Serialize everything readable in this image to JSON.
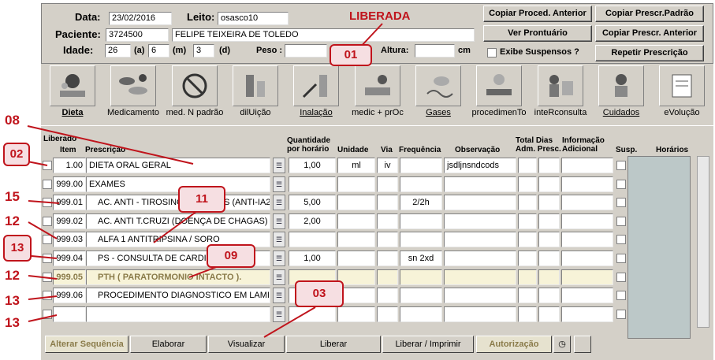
{
  "header": {
    "data_label": "Data:",
    "data_value": "23/02/2016",
    "leito_label": "Leito:",
    "leito_value": "osasco10",
    "status": "LIBERADA",
    "paciente_label": "Paciente:",
    "paciente_id": "3724500",
    "paciente_nome": "FELIPE TEIXEIRA DE TOLEDO",
    "idade_label": "Idade:",
    "idade_anos": "26",
    "anos_unit": "(a)",
    "idade_meses": "6",
    "meses_unit": "(m)",
    "idade_dias": "3",
    "dias_unit": "(d)",
    "peso_label": "Peso :",
    "peso_unit": "kg",
    "altura_label": "Altura:",
    "altura_unit": "cm",
    "exibe_suspensos": "Exibe Suspensos ?"
  },
  "actions": {
    "copiar_proced": "Copiar Proced. Anterior",
    "copiar_padrao": "Copiar Prescr.Padrão",
    "ver_prontuario": "Ver Prontuário",
    "copiar_anterior": "Copiar Prescr. Anterior",
    "repetir": "Repetir Prescrição"
  },
  "toolbar": [
    {
      "label": "Dieta",
      "icon": "meal-icon"
    },
    {
      "label": "Medicamento",
      "icon": "pills-icon"
    },
    {
      "label": "med. N padrão",
      "icon": "no-medicine-icon"
    },
    {
      "label": "dilUição",
      "icon": "vial-icon"
    },
    {
      "label": "Inalação",
      "icon": "inhaler-icon"
    },
    {
      "label": "medic + prOc",
      "icon": "medic-procedure-icon"
    },
    {
      "label": "Gases",
      "icon": "gas-icon"
    },
    {
      "label": "procedimenTo",
      "icon": "procedure-icon"
    },
    {
      "label": "inteRconsulta",
      "icon": "consultation-icon"
    },
    {
      "label": "Cuidados",
      "icon": "care-icon"
    },
    {
      "label": "eVolução",
      "icon": "evolution-icon"
    }
  ],
  "grid": {
    "headers": {
      "liberado": "Liberado",
      "item": "Item",
      "prescricao": "Prescrição",
      "quantidade": "Quantidade por horário",
      "unidade": "Unidade",
      "via": "Via",
      "frequencia": "Frequência",
      "observacao": "Observação",
      "total_dias": "Total Dias Adm. Presc.",
      "informacao": "Informação Adicional",
      "susp": "Susp.",
      "horarios": "Horários"
    },
    "rows": [
      {
        "item": "1.00",
        "prescricao": "DIETA ORAL GERAL",
        "quantidade": "1,00",
        "unidade": "ml",
        "via": "iv",
        "frequencia": "",
        "observacao": "jsdljnsndcods"
      },
      {
        "item": "999.00",
        "prescricao": "EXAMES",
        "quantidade": "",
        "unidade": "",
        "via": "",
        "frequencia": "",
        "observacao": ""
      },
      {
        "item": "999.01",
        "prescricao": "AC. ANTI - TIROSINO FOSFATAS (ANTI-IA2)",
        "quantidade": "5,00",
        "unidade": "",
        "via": "",
        "frequencia": "2/2h",
        "observacao": ""
      },
      {
        "item": "999.02",
        "prescricao": "AC. ANTI T.CRUZI (DOENÇA DE CHAGAS)",
        "quantidade": "2,00",
        "unidade": "",
        "via": "",
        "frequencia": "",
        "observacao": ""
      },
      {
        "item": "999.03",
        "prescricao": "ALFA 1 ANTITRIPSINA / SORO",
        "quantidade": "",
        "unidade": "",
        "via": "",
        "frequencia": "",
        "observacao": ""
      },
      {
        "item": "999.04",
        "prescricao": "PS - CONSULTA DE CARDIOLOGIA",
        "quantidade": "1,00",
        "unidade": "",
        "via": "",
        "frequencia": "sn 2xd",
        "observacao": ""
      },
      {
        "item": "999.05",
        "prescricao": "PTH ( PARATORMONIO INTACTO ).",
        "quantidade": "",
        "unidade": "",
        "via": "",
        "frequencia": "",
        "observacao": ""
      },
      {
        "item": "999.06",
        "prescricao": "PROCEDIMENTO DIAGNOSTICO EM LAMINAS",
        "quantidade": "",
        "unidade": "",
        "via": "",
        "frequencia": "",
        "observacao": ""
      },
      {
        "item": "",
        "prescricao": "",
        "quantidade": "",
        "unidade": "",
        "via": "",
        "frequencia": "",
        "observacao": ""
      }
    ]
  },
  "bottom": {
    "alterar": "Alterar Sequência",
    "elaborar": "Elaborar",
    "visualizar": "Visualizar",
    "liberar": "Liberar",
    "liberar_imprimir": "Liberar / Imprimir",
    "autorizacao": "Autorização"
  },
  "annotations": {
    "c01": "01",
    "c02": "02",
    "c03": "03",
    "c08": "08",
    "c09": "09",
    "c11": "11",
    "c12a": "12",
    "c12b": "12",
    "c13a": "13",
    "c13b": "13",
    "c13c": "13",
    "c15": "15"
  },
  "colors": {
    "accent_red": "#c0141c",
    "panel": "#d4d0c8",
    "selected_row": "#f7f3d8"
  }
}
